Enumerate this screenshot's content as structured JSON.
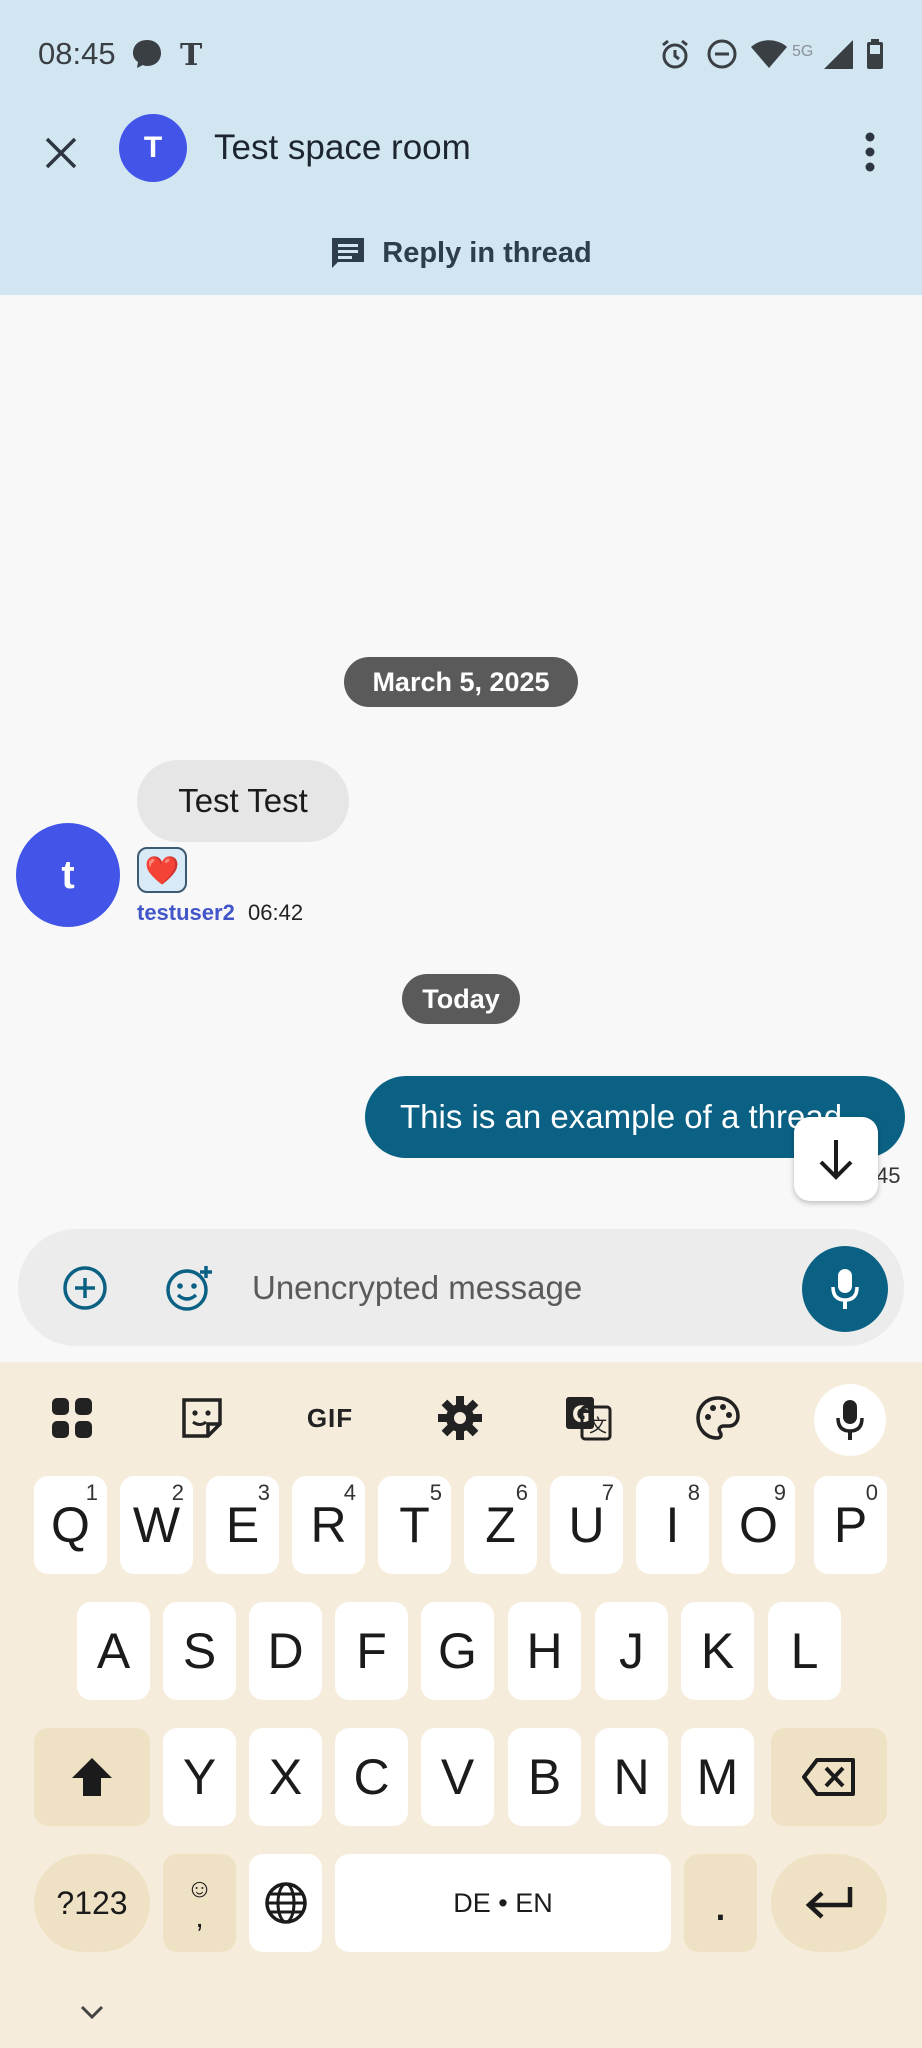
{
  "status_bar": {
    "time": "08:45",
    "network": "5G",
    "icons": [
      "messenger-icon",
      "nyt-icon",
      "alarm-icon",
      "dnd-icon",
      "wifi-icon",
      "signal-icon",
      "battery-icon"
    ]
  },
  "header": {
    "room_avatar_letter": "T",
    "room_name": "Test space room",
    "thread_label": "Reply in thread",
    "accent_color": "#d2e6f2"
  },
  "timeline": {
    "date_separator_1": "March 5, 2025",
    "message_1": {
      "text": "Test Test",
      "avatar_letter": "t",
      "sender": "testuser2",
      "time": "06:42",
      "reaction": "❤️"
    },
    "date_separator_2": "Today",
    "message_2": {
      "text": "This is an example of a thread",
      "time_partial": "45"
    }
  },
  "composer": {
    "placeholder": "Unencrypted message"
  },
  "keyboard": {
    "row1": [
      {
        "label": "Q",
        "hint": "1"
      },
      {
        "label": "W",
        "hint": "2"
      },
      {
        "label": "E",
        "hint": "3"
      },
      {
        "label": "R",
        "hint": "4"
      },
      {
        "label": "T",
        "hint": "5"
      },
      {
        "label": "Z",
        "hint": "6"
      },
      {
        "label": "U",
        "hint": "7"
      },
      {
        "label": "I",
        "hint": "8"
      },
      {
        "label": "O",
        "hint": "9"
      },
      {
        "label": "P",
        "hint": "0"
      }
    ],
    "row2": [
      "A",
      "S",
      "D",
      "F",
      "G",
      "H",
      "J",
      "K",
      "L"
    ],
    "row3": [
      "Y",
      "X",
      "C",
      "V",
      "B",
      "N",
      "M"
    ],
    "symbols_label": "?123",
    "emoji_comma_top": "☺",
    "emoji_comma_bottom": ",",
    "space_label": "DE • EN",
    "period_label": ".",
    "toolbar_gif": "GIF"
  }
}
